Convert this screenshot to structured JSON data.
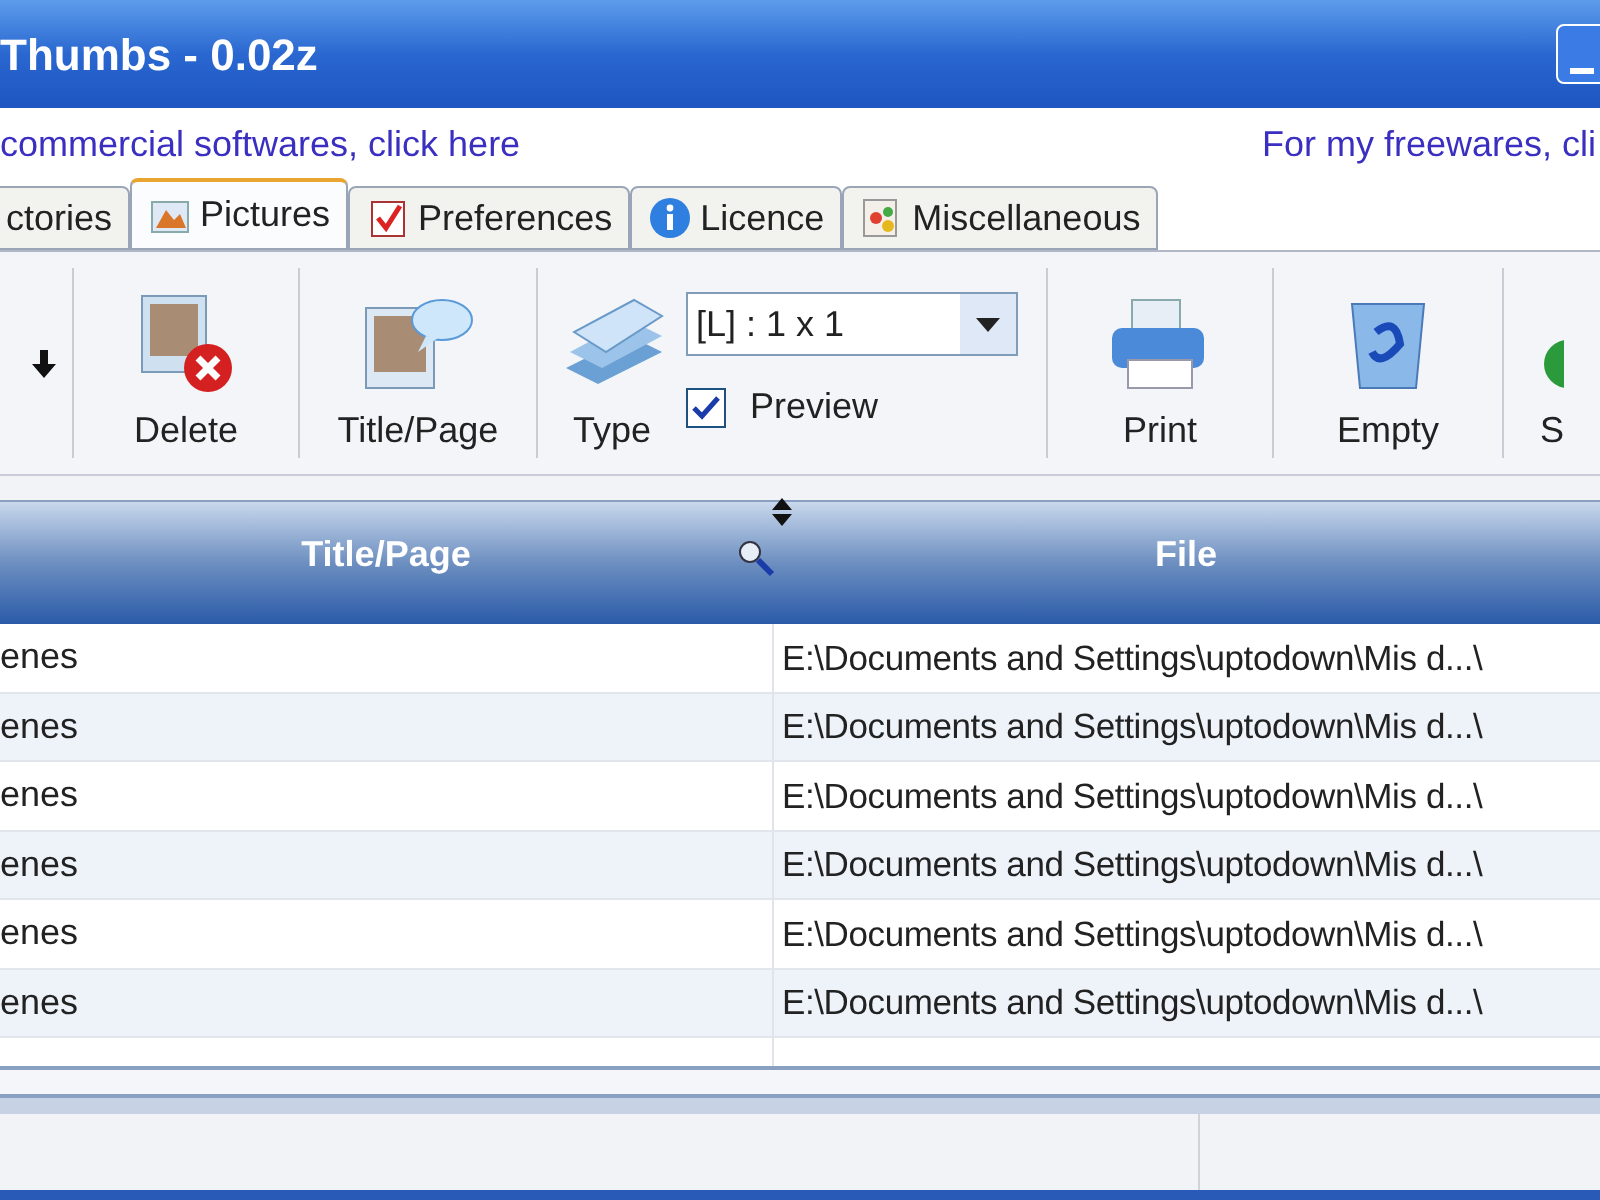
{
  "window": {
    "title": "Thumbs - 0.02z"
  },
  "links": [
    "commercial softwares, click here",
    "For my freewares, cli"
  ],
  "tabs": [
    {
      "label": "ctories",
      "selected": false
    },
    {
      "label": "Pictures",
      "selected": true
    },
    {
      "label": "Preferences",
      "selected": false
    },
    {
      "label": "Licence",
      "selected": false
    },
    {
      "label": "Miscellaneous",
      "selected": false
    }
  ],
  "toolbar": [
    {
      "kind": "arrow"
    },
    {
      "kind": "delete",
      "label": "Delete"
    },
    {
      "kind": "title",
      "label": "Title/Page"
    },
    {
      "kind": "type",
      "label": "Type",
      "select": "[L] : 1 x 1",
      "preview": {
        "label": "Preview",
        "checked": true
      }
    },
    {
      "kind": "print",
      "label": "Print"
    },
    {
      "kind": "empty",
      "label": "Empty"
    },
    {
      "kind": "save",
      "label": "S"
    }
  ],
  "table": {
    "columns": [
      "Title/Page",
      "File"
    ],
    "rows": [
      {
        "title": "enes",
        "file": "E:\\Documents and Settings\\uptodown\\Mis d...\\",
        "selected": false
      },
      {
        "title": "enes",
        "file": "E:\\Documents and Settings\\uptodown\\Mis d...\\",
        "selected": false
      },
      {
        "title": "enes",
        "file": "E:\\Documents and Settings\\uptodown\\Mis d...\\",
        "selected": false
      },
      {
        "title": "enes",
        "file": "E:\\Documents and Settings\\uptodown\\Mis d...\\",
        "selected": false
      },
      {
        "title": "enes",
        "file": "E:\\Documents and Settings\\uptodown\\Mis d...\\",
        "selected": false
      },
      {
        "title": "enes",
        "file": "E:\\Documents and Settings\\uptodown\\Mis d...\\",
        "selected": false
      }
    ]
  }
}
